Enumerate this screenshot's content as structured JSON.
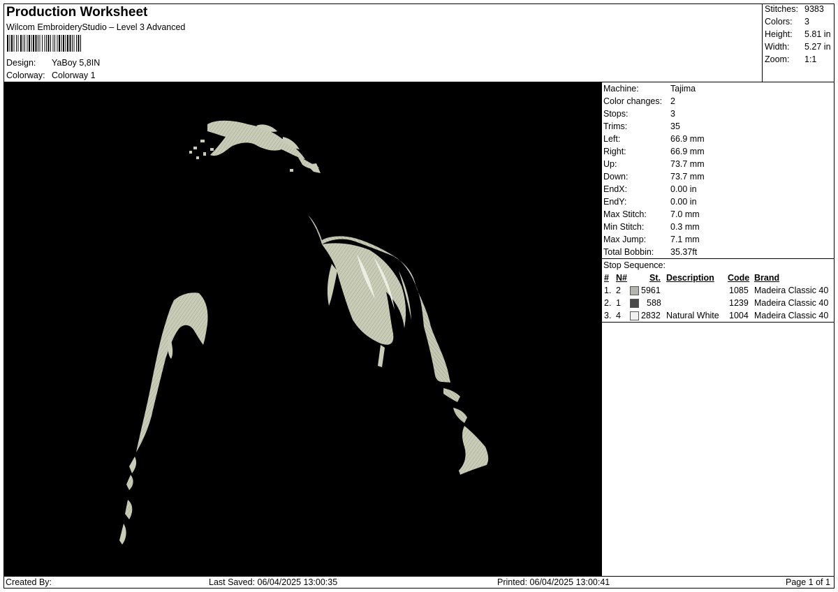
{
  "header": {
    "title": "Production Worksheet",
    "software": "Wilcom EmbroideryStudio – Level 3 Advanced",
    "design_label": "Design:",
    "design_value": "YaBoy 5,8IN",
    "colorway_label": "Colorway:",
    "colorway_value": "Colorway 1"
  },
  "summary": [
    {
      "label": "Stitches:",
      "value": "9383"
    },
    {
      "label": "Colors:",
      "value": "3"
    },
    {
      "label": "Height:",
      "value": "5.81 in"
    },
    {
      "label": "Width:",
      "value": "5.27 in"
    },
    {
      "label": "Zoom:",
      "value": "1:1"
    }
  ],
  "machine_stats": [
    {
      "label": "Machine:",
      "value": "Tajima"
    },
    {
      "label": "Color changes:",
      "value": "2"
    },
    {
      "label": "Stops:",
      "value": "3"
    },
    {
      "label": "Trims:",
      "value": "35"
    },
    {
      "label": "Left:",
      "value": "66.9 mm"
    },
    {
      "label": "Right:",
      "value": "66.9 mm"
    },
    {
      "label": "Up:",
      "value": "73.7 mm"
    },
    {
      "label": "Down:",
      "value": "73.7 mm"
    },
    {
      "label": "EndX:",
      "value": "0.00 in"
    },
    {
      "label": "EndY:",
      "value": "0.00 in"
    },
    {
      "label": "Max Stitch:",
      "value": "7.0 mm"
    },
    {
      "label": "Min Stitch:",
      "value": "0.3 mm"
    },
    {
      "label": "Max Jump:",
      "value": "7.1 mm"
    },
    {
      "label": "Total Bobbin:",
      "value": "35.37ft"
    }
  ],
  "stop_sequence": {
    "title": "Stop Sequence:",
    "headers": {
      "num": "#",
      "needle": "N#",
      "stitches": "St.",
      "description": "Description",
      "code": "Code",
      "brand": "Brand"
    },
    "rows": [
      {
        "num": "1.",
        "needle": "2",
        "color": "#b5b5ad",
        "stitches": "5961",
        "description": "",
        "code": "1085",
        "brand": "Madeira Classic 40"
      },
      {
        "num": "2.",
        "needle": "1",
        "color": "#4a4a4a",
        "stitches": "588",
        "description": "",
        "code": "1239",
        "brand": "Madeira Classic 40"
      },
      {
        "num": "3.",
        "needle": "4",
        "color": "#f0f0f2",
        "stitches": "2832",
        "description": "Natural White",
        "code": "1004",
        "brand": "Madeira Classic 40"
      }
    ]
  },
  "footer": {
    "created_by": "Created By:",
    "last_saved": "Last Saved: 06/04/2025 13:00:35",
    "printed": "Printed: 06/04/2025 13:00:41",
    "page": "Page 1 of 1"
  },
  "colors": {
    "canvas_background": "#000000",
    "stitch_fill": "#c9cdb8",
    "stitch_shadow": "#8d9282"
  }
}
